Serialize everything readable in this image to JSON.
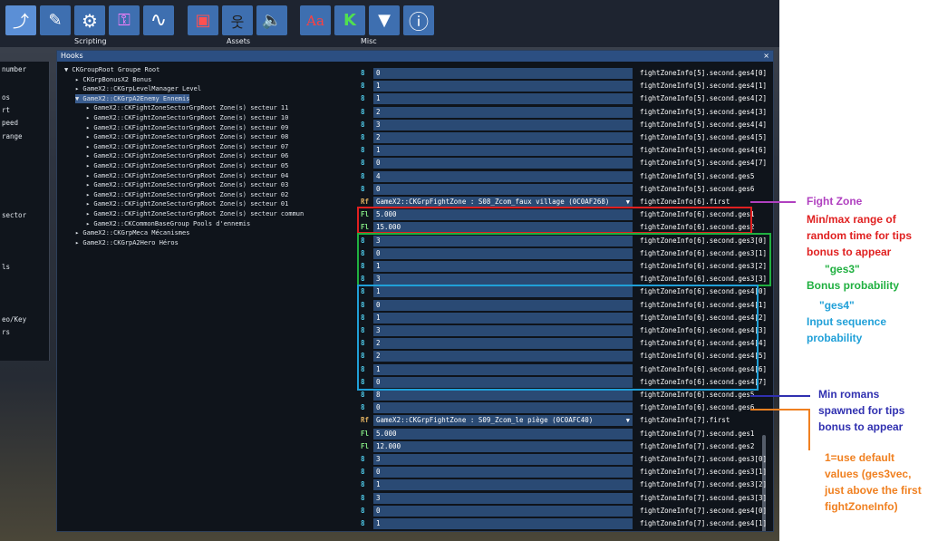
{
  "toolbar": {
    "groups": {
      "scripting": "Scripting",
      "assets": "Assets",
      "misc": "Misc"
    },
    "buttons": [
      {
        "icon": "hook-icon",
        "glyph": "⤴"
      },
      {
        "icon": "pen-icon",
        "glyph": "✎"
      },
      {
        "icon": "gear-icon",
        "glyph": "⚙"
      },
      {
        "icon": "grid-icon",
        "glyph": "⚿"
      },
      {
        "icon": "wave-icon",
        "glyph": "∿"
      },
      {
        "icon": "image-edit-icon",
        "glyph": "▣"
      },
      {
        "icon": "characters-icon",
        "glyph": "웃"
      },
      {
        "icon": "speaker-icon",
        "glyph": "🔈"
      },
      {
        "icon": "font-icon",
        "glyph": "Aa"
      },
      {
        "icon": "package-icon",
        "glyph": "K"
      },
      {
        "icon": "dropdown-icon",
        "glyph": "▼"
      },
      {
        "icon": "info-icon",
        "glyph": "ⓘ"
      }
    ]
  },
  "left_panel": [
    "number",
    "os",
    "rt",
    "peed",
    "range",
    "",
    "sector",
    "ls",
    "eo/Key",
    "rs"
  ],
  "hooks_window": {
    "title": "Hooks",
    "close": "×"
  },
  "tree": [
    {
      "label": "▼ CKGroupRoot Groupe Root",
      "indent": 0
    },
    {
      "label": "▸ CKGrpBonusX2 Bonus",
      "indent": 1
    },
    {
      "label": "▸ GameX2::CKGrpLevelManager Level",
      "indent": 1
    },
    {
      "label": "▼ GameX2::CKGrpA2Enemy Ennemis",
      "indent": 1,
      "selected": true
    },
    {
      "label": "▸ GameX2::CKFightZoneSectorGrpRoot Zone(s) secteur 11",
      "indent": 2
    },
    {
      "label": "▸ GameX2::CKFightZoneSectorGrpRoot Zone(s) secteur 10",
      "indent": 2
    },
    {
      "label": "▸ GameX2::CKFightZoneSectorGrpRoot Zone(s) secteur 09",
      "indent": 2
    },
    {
      "label": "▸ GameX2::CKFightZoneSectorGrpRoot Zone(s) secteur 08",
      "indent": 2
    },
    {
      "label": "▸ GameX2::CKFightZoneSectorGrpRoot Zone(s) secteur 07",
      "indent": 2
    },
    {
      "label": "▸ GameX2::CKFightZoneSectorGrpRoot Zone(s) secteur 06",
      "indent": 2
    },
    {
      "label": "▸ GameX2::CKFightZoneSectorGrpRoot Zone(s) secteur 05",
      "indent": 2
    },
    {
      "label": "▸ GameX2::CKFightZoneSectorGrpRoot Zone(s) secteur 04",
      "indent": 2
    },
    {
      "label": "▸ GameX2::CKFightZoneSectorGrpRoot Zone(s) secteur 03",
      "indent": 2
    },
    {
      "label": "▸ GameX2::CKFightZoneSectorGrpRoot Zone(s) secteur 02",
      "indent": 2
    },
    {
      "label": "▸ GameX2::CKFightZoneSectorGrpRoot Zone(s) secteur 01",
      "indent": 2
    },
    {
      "label": "▸ GameX2::CKFightZoneSectorGrpRoot Zone(s) secteur commun",
      "indent": 2
    },
    {
      "label": "▸ GameX2::CKCommonBaseGroup Pools d'ennemis",
      "indent": 2
    },
    {
      "label": "▸ GameX2::CKGrpMeca Mécanismes",
      "indent": 1
    },
    {
      "label": "▸ GameX2::CKGrpA2Hero Héros",
      "indent": 1
    }
  ],
  "rows": [
    {
      "type": "8",
      "value": "0",
      "name": "fightZoneInfo[5].second.ges4[0]"
    },
    {
      "type": "8",
      "value": "1",
      "name": "fightZoneInfo[5].second.ges4[1]"
    },
    {
      "type": "8",
      "value": "1",
      "name": "fightZoneInfo[5].second.ges4[2]"
    },
    {
      "type": "8",
      "value": "2",
      "name": "fightZoneInfo[5].second.ges4[3]"
    },
    {
      "type": "8",
      "value": "3",
      "name": "fightZoneInfo[5].second.ges4[4]"
    },
    {
      "type": "8",
      "value": "2",
      "name": "fightZoneInfo[5].second.ges4[5]"
    },
    {
      "type": "8",
      "value": "1",
      "name": "fightZoneInfo[5].second.ges4[6]"
    },
    {
      "type": "8",
      "value": "0",
      "name": "fightZoneInfo[5].second.ges4[7]"
    },
    {
      "type": "8",
      "value": "4",
      "name": "fightZoneInfo[5].second.ges5"
    },
    {
      "type": "8",
      "value": "0",
      "name": "fightZoneInfo[5].second.ges6"
    },
    {
      "type": "Rf",
      "value": "GameX2::CKGrpFightZone : S08_Zcom_faux village (0C0AF268)",
      "name": "fightZoneInfo[6].first",
      "dropdown": true
    },
    {
      "type": "Fl",
      "value": "5.000",
      "name": "fightZoneInfo[6].second.ges1"
    },
    {
      "type": "Fl",
      "value": "15.000",
      "name": "fightZoneInfo[6].second.ges2"
    },
    {
      "type": "8",
      "value": "3",
      "name": "fightZoneInfo[6].second.ges3[0]"
    },
    {
      "type": "8",
      "value": "0",
      "name": "fightZoneInfo[6].second.ges3[1]"
    },
    {
      "type": "8",
      "value": "1",
      "name": "fightZoneInfo[6].second.ges3[2]"
    },
    {
      "type": "8",
      "value": "3",
      "name": "fightZoneInfo[6].second.ges3[3]"
    },
    {
      "type": "8",
      "value": "1",
      "name": "fightZoneInfo[6].second.ges4[0]"
    },
    {
      "type": "8",
      "value": "0",
      "name": "fightZoneInfo[6].second.ges4[1]"
    },
    {
      "type": "8",
      "value": "1",
      "name": "fightZoneInfo[6].second.ges4[2]"
    },
    {
      "type": "8",
      "value": "3",
      "name": "fightZoneInfo[6].second.ges4[3]"
    },
    {
      "type": "8",
      "value": "2",
      "name": "fightZoneInfo[6].second.ges4[4]"
    },
    {
      "type": "8",
      "value": "2",
      "name": "fightZoneInfo[6].second.ges4[5]"
    },
    {
      "type": "8",
      "value": "1",
      "name": "fightZoneInfo[6].second.ges4[6]"
    },
    {
      "type": "8",
      "value": "0",
      "name": "fightZoneInfo[6].second.ges4[7]"
    },
    {
      "type": "8",
      "value": "8",
      "name": "fightZoneInfo[6].second.ges5"
    },
    {
      "type": "8",
      "value": "0",
      "name": "fightZoneInfo[6].second.ges6"
    },
    {
      "type": "Rf",
      "value": "GameX2::CKGrpFightZone : S09_Zcom_le piège (0C0AFC40)",
      "name": "fightZoneInfo[7].first",
      "dropdown": true
    },
    {
      "type": "Fl",
      "value": "5.000",
      "name": "fightZoneInfo[7].second.ges1"
    },
    {
      "type": "Fl",
      "value": "12.000",
      "name": "fightZoneInfo[7].second.ges2"
    },
    {
      "type": "8",
      "value": "3",
      "name": "fightZoneInfo[7].second.ges3[0]"
    },
    {
      "type": "8",
      "value": "0",
      "name": "fightZoneInfo[7].second.ges3[1]"
    },
    {
      "type": "8",
      "value": "1",
      "name": "fightZoneInfo[7].second.ges3[2]"
    },
    {
      "type": "8",
      "value": "3",
      "name": "fightZoneInfo[7].second.ges3[3]"
    },
    {
      "type": "8",
      "value": "0",
      "name": "fightZoneInfo[7].second.ges4[0]"
    },
    {
      "type": "8",
      "value": "1",
      "name": "fightZoneInfo[7].second.ges4[1]"
    }
  ],
  "annotations": {
    "fight_zone": "Fight Zone",
    "minmax": [
      "Min/max range of",
      "random time for tips",
      "bonus to appear"
    ],
    "ges3": [
      "\"ges3\"",
      "Bonus probability"
    ],
    "ges4": [
      "\"ges4\"",
      "Input sequence",
      "probability"
    ],
    "romans": [
      "Min romans",
      "spawned for tips",
      "bonus to appear"
    ],
    "default": [
      "1=use default",
      "values (ges3vec,",
      "just above the first",
      "fightZoneInfo)"
    ]
  },
  "colors": {
    "purple": "#b040c0",
    "red": "#e02020",
    "green": "#20b040",
    "cyan": "#20a0d8",
    "navy": "#3030b0",
    "orange": "#f08020",
    "row_bg": "#2a4a74",
    "title_bar": "#2c4f82"
  }
}
